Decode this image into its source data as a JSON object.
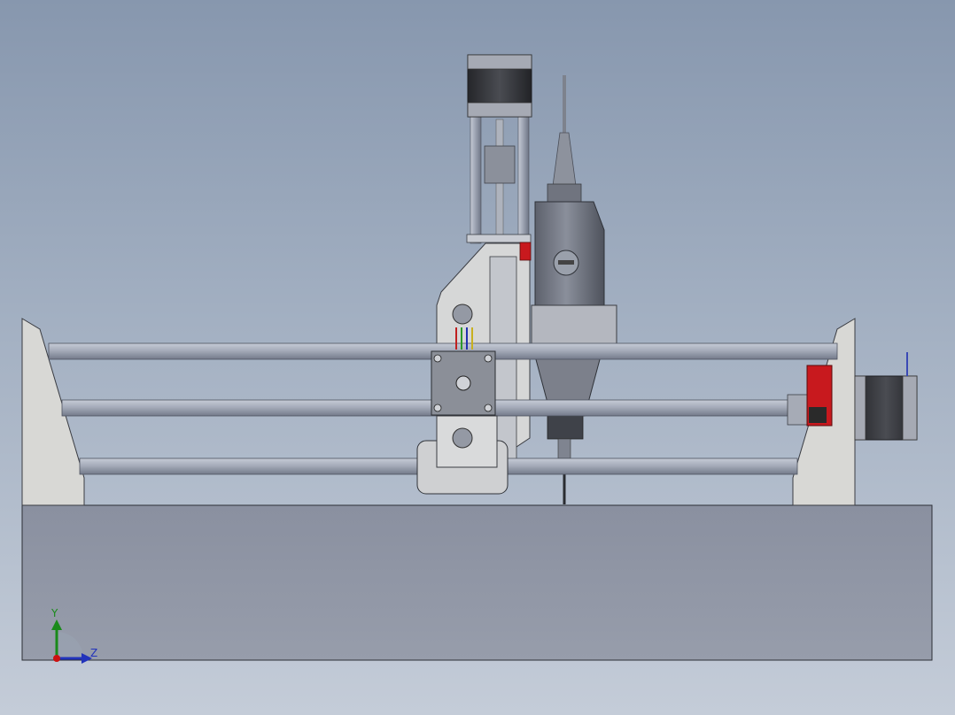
{
  "viewport": {
    "background_top": "#8797ae",
    "background_bottom": "#c4ccd8"
  },
  "colors": {
    "frame": "#8f95a3",
    "rod": "#a9afbc",
    "rod_shadow": "#7b8190",
    "bracket": "#d9d9d6",
    "stepper_body": "#3a3b3f",
    "part_grey": "#b8bbc3",
    "dark_part": "#6d717c",
    "pcb_red": "#c8191e"
  },
  "triad": {
    "y_label": "Y",
    "z_label": "Z",
    "x_color": "#cc1111",
    "y_color": "#1a8a1a",
    "z_color": "#2233bb"
  }
}
